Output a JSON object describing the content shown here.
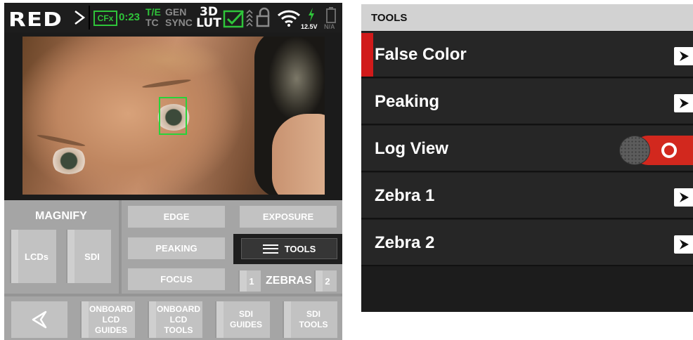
{
  "status_bar": {
    "brand": "RED",
    "cfx_label": "CFx",
    "cfx_time": "0:23",
    "te_label": "T/E",
    "tc_label": "TC",
    "gen_label": "GEN",
    "sync_label": "SYNC",
    "lut_label_top": "3D",
    "lut_label_bottom": "LUT",
    "voltage": "12.5V",
    "battery_status": "N/A",
    "colors": {
      "green": "#2fc43a",
      "gray": "#8a8a8a"
    }
  },
  "monitor_controls": {
    "magnify_label": "MAGNIFY",
    "lcds_button": "LCDs",
    "sdi_button": "SDI",
    "edge_button": "EDGE",
    "exposure_button": "EXPOSURE",
    "peaking_button": "PEAKING",
    "tools_button": "TOOLS",
    "focus_button": "FOCUS",
    "zebras_label": "ZEBRAS",
    "zebra_1_button": "1",
    "zebra_2_button": "2"
  },
  "bottom_bar": {
    "back_icon": "back-arrow-icon",
    "items": [
      {
        "line1": "ONBOARD",
        "line2": "LCD",
        "line3": "GUIDES"
      },
      {
        "line1": "ONBOARD",
        "line2": "LCD",
        "line3": "TOOLS"
      },
      {
        "line1": "SDI",
        "line2": "GUIDES"
      },
      {
        "line1": "SDI",
        "line2": "TOOLS"
      }
    ]
  },
  "tools_menu": {
    "header": "TOOLS",
    "items": [
      {
        "label": "False Color",
        "control": "chevron",
        "selected": true
      },
      {
        "label": "Peaking",
        "control": "chevron",
        "selected": false
      },
      {
        "label": "Log View",
        "control": "toggle",
        "toggle_on": true
      },
      {
        "label": "Zebra 1",
        "control": "chevron"
      },
      {
        "label": "Zebra 2",
        "control": "chevron"
      }
    ],
    "accent_color": "#d11a1a"
  }
}
